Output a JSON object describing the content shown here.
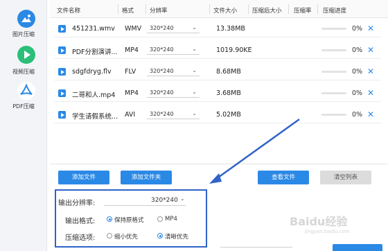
{
  "sidebar": {
    "items": [
      {
        "label": "图片压缩",
        "icon": "image-icon"
      },
      {
        "label": "视频压缩",
        "icon": "play-icon"
      },
      {
        "label": "PDF压缩",
        "icon": "pdf-icon"
      }
    ]
  },
  "table": {
    "headers": [
      "文件名称",
      "格式",
      "分辨率",
      "文件大小",
      "压缩后大小",
      "压缩率",
      "压缩进度"
    ],
    "rows": [
      {
        "name": "451231.wmv",
        "format": "WMV",
        "resolution": "320*240",
        "size": "13.38MB",
        "percent": "0%"
      },
      {
        "name": "PDF分割演讲...",
        "format": "MP4",
        "resolution": "320*240",
        "size": "1019.90KE",
        "percent": "0%"
      },
      {
        "name": "sdgfdryg.flv",
        "format": "FLV",
        "resolution": "320*240",
        "size": "8.68MB",
        "percent": "0%"
      },
      {
        "name": "二哥和人.mp4",
        "format": "MP4",
        "resolution": "320*240",
        "size": "3.68MB",
        "percent": "0%"
      },
      {
        "name": "学生请假系统...",
        "format": "AVI",
        "resolution": "320*240",
        "size": "5.02MB",
        "percent": "0%"
      }
    ]
  },
  "buttons": {
    "add_file": "添加文件",
    "add_folder": "添加文件夹",
    "view_file": "查看文件",
    "clear_list": "清空列表"
  },
  "options": {
    "resolution_label": "输出分辨率:",
    "resolution_value": "320*240",
    "format_label": "输出格式:",
    "format_keep": "保持原格式",
    "format_mp4": "MP4",
    "compress_label": "压缩选项:",
    "compress_small": "缩小优先",
    "compress_clear": "清晰优先"
  },
  "watermark": {
    "text": "Baidu经验",
    "sub": "jingyan.baidu.com"
  },
  "colors": {
    "accent": "#2b89e6",
    "highlight": "#2f63c7"
  }
}
